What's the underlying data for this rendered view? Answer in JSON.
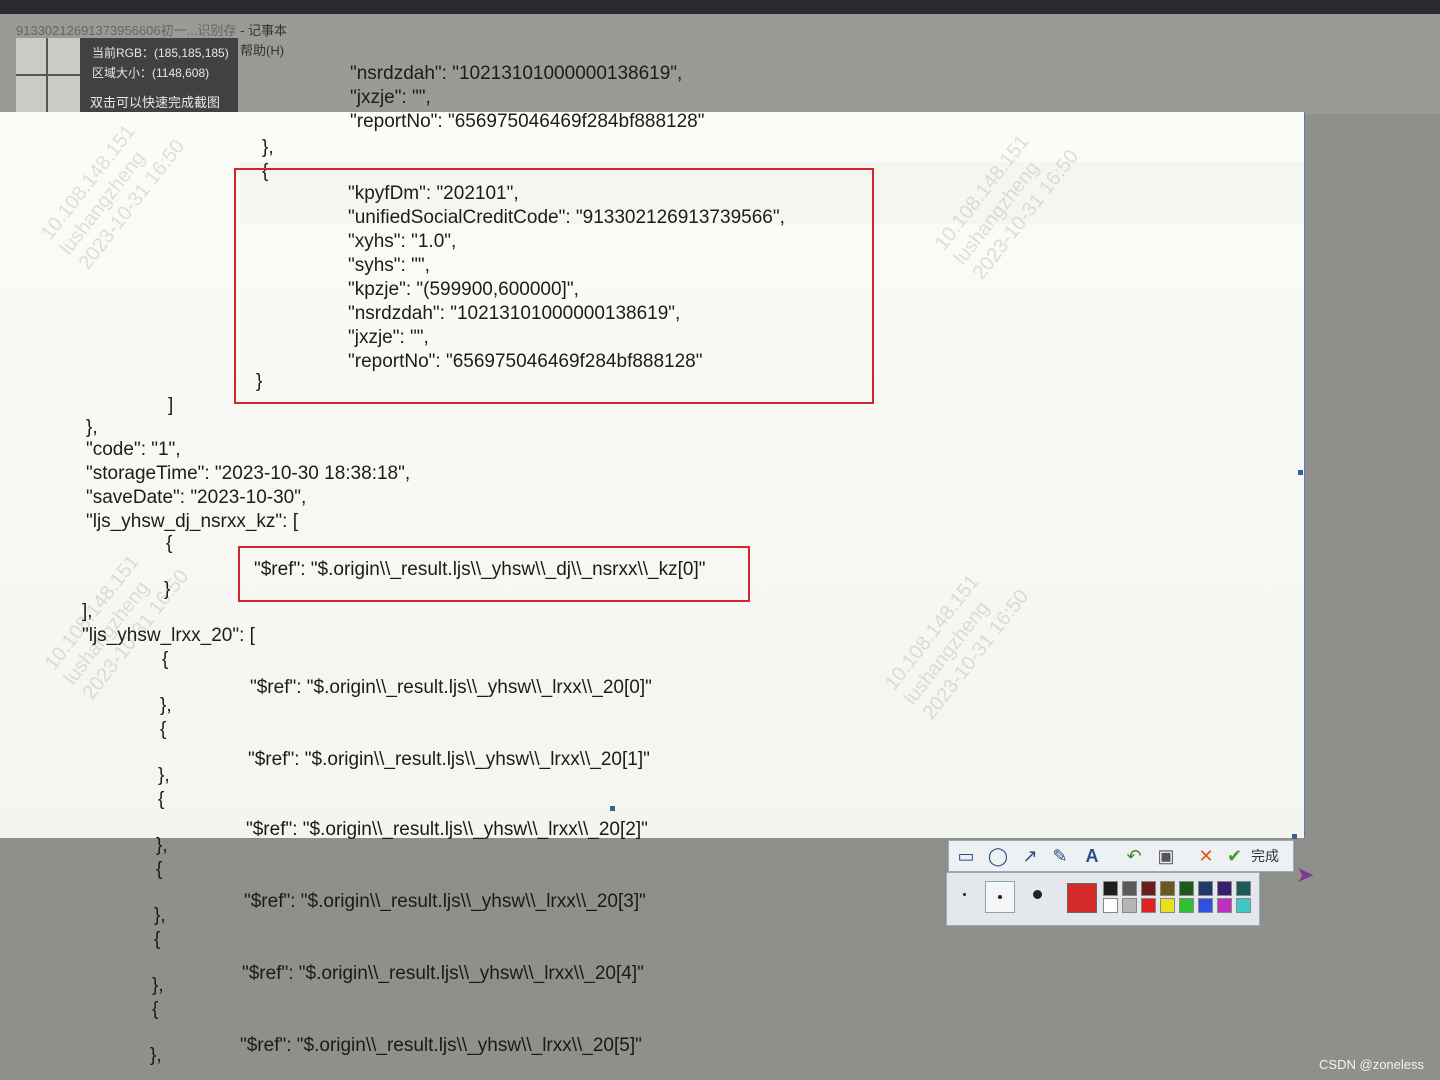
{
  "window": {
    "title_fragment": "91330212691373956606初一...识别存",
    "app_suffix": "- 记事本",
    "menu_help": "帮助(H)"
  },
  "capture_info": {
    "rgb": "当前RGB：(185,185,185)",
    "size": "区域大小：(1148,608)",
    "hint": "双击可以快速完成截图"
  },
  "editor": {
    "lines_top": [
      "\"nsrdzdah\": \"10213101000000138619\",",
      "\"jxzje\": \"\",",
      "\"reportNo\": \"656975046469f284bf888128\""
    ],
    "close_open": [
      "},",
      "{"
    ],
    "boxed_object": [
      "\"kpyfDm\": \"202101\",",
      "\"unifiedSocialCreditCode\": \"913302126913739566\",",
      "\"xyhs\": \"1.0\",",
      "\"syhs\": \"\",",
      "\"kpzje\": \"(599900,600000]\",",
      "\"nsrdzdah\": \"10213101000000138619\",",
      "\"jxzje\": \"\",",
      "\"reportNo\": \"656975046469f284bf888128\""
    ],
    "boxed_close": "}",
    "array_close": "]",
    "obj_close": "},",
    "fields": [
      "\"code\": \"1\",",
      "\"storageTime\": \"2023-10-30 18:38:18\",",
      "\"saveDate\": \"2023-10-30\",",
      "\"ljs_yhsw_dj_nsrxx_kz\": ["
    ],
    "kz_open": "{",
    "kz_ref": "\"$ref\": \"$.origin\\\\_result.ljs\\\\_yhsw\\\\_dj\\\\_nsrxx\\\\_kz[0]\"",
    "kz_close": "}",
    "kz_array_close": "],",
    "lrxx_key": "\"ljs_yhsw_lrxx_20\": [",
    "lrxx_refs": [
      "\"$ref\": \"$.origin\\\\_result.ljs\\\\_yhsw\\\\_lrxx\\\\_20[0]\"",
      "\"$ref\": \"$.origin\\\\_result.ljs\\\\_yhsw\\\\_lrxx\\\\_20[1]\"",
      "\"$ref\": \"$.origin\\\\_result.ljs\\\\_yhsw\\\\_lrxx\\\\_20[2]\"",
      "\"$ref\": \"$.origin\\\\_result.ljs\\\\_yhsw\\\\_lrxx\\\\_20[3]\"",
      "\"$ref\": \"$.origin\\\\_result.ljs\\\\_yhsw\\\\_lrxx\\\\_20[4]\"",
      "\"$ref\": \"$.origin\\\\_result.ljs\\\\_yhsw\\\\_lrxx\\\\_20[5]\""
    ],
    "brace_open": "{",
    "brace_close": "},"
  },
  "watermark": {
    "ip": "10.108.148.151",
    "user": "lushangzheng",
    "time": "2023-10-31 16:50"
  },
  "toolbar": {
    "icons": [
      "rectangle-icon",
      "ellipse-icon",
      "arrow-icon",
      "brush-icon",
      "text-icon",
      "undo-icon",
      "save-icon",
      "cancel-icon",
      "confirm-icon"
    ],
    "done_label": "完成"
  },
  "palette": {
    "selected_color": "#d42a2a",
    "colors": [
      "#1e1e1e",
      "#5a5a5a",
      "#6b1e1e",
      "#6b5a1e",
      "#1e5a1e",
      "#1e3a6b",
      "#3a1e6b",
      "#1e5a5a",
      "#ffffff",
      "#b4b4b4",
      "#e22222",
      "#e8e020",
      "#30c030",
      "#3050e0",
      "#c030c0",
      "#40c8c8"
    ]
  },
  "credit": "CSDN @zoneless"
}
